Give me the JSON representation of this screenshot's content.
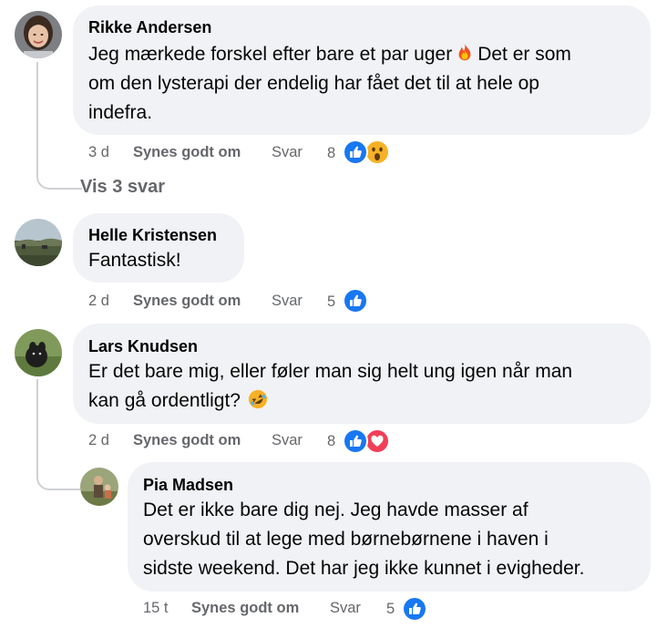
{
  "comments": [
    {
      "author": "Rikke Andersen",
      "text_before_emoji": "Jeg mærkede forskel efter bare et par uger",
      "emoji": "fire-emoji",
      "text_line1_after": "Det er som",
      "text_line2": "om den lysterapi der endelig har fået det til at hele op",
      "text_line3": "indefra.",
      "time": "3 d",
      "like_label": "Synes godt om",
      "reply_label": "Svar",
      "reaction_count": "8",
      "reactions": [
        "like",
        "wow"
      ]
    },
    {
      "author": "Helle Kristensen",
      "text": "Fantastisk!",
      "time": "2 d",
      "like_label": "Synes godt om",
      "reply_label": "Svar",
      "reaction_count": "5",
      "reactions": [
        "like"
      ]
    },
    {
      "author": "Lars Knudsen",
      "text_line1": "Er det bare mig, eller føler man sig helt ung igen når man",
      "text_line2": "kan gå ordentligt?",
      "emoji": "rofl-emoji",
      "time": "2 d",
      "like_label": "Synes godt om",
      "reply_label": "Svar",
      "reaction_count": "8",
      "reactions": [
        "like",
        "love"
      ]
    },
    {
      "author": "Pia Madsen",
      "text_line1": "Det er ikke bare dig nej. Jeg havde masser af",
      "text_line2": "overskud til at lege med børnebørnene i haven i",
      "text_line3": "sidste weekend. Det har jeg ikke kunnet i evigheder.",
      "time": "15 t",
      "like_label": "Synes godt om",
      "reply_label": "Svar",
      "reaction_count": "5",
      "reactions": [
        "like"
      ]
    }
  ],
  "view_replies_label": "Vis 3 svar",
  "colors": {
    "bubble": "#f0f2f5",
    "secondary_text": "#65676b",
    "like_blue": "#1877f2",
    "love_red": "#f33e58",
    "wow_yellow": "#f7b125",
    "thread_line": "#ced0d4"
  }
}
